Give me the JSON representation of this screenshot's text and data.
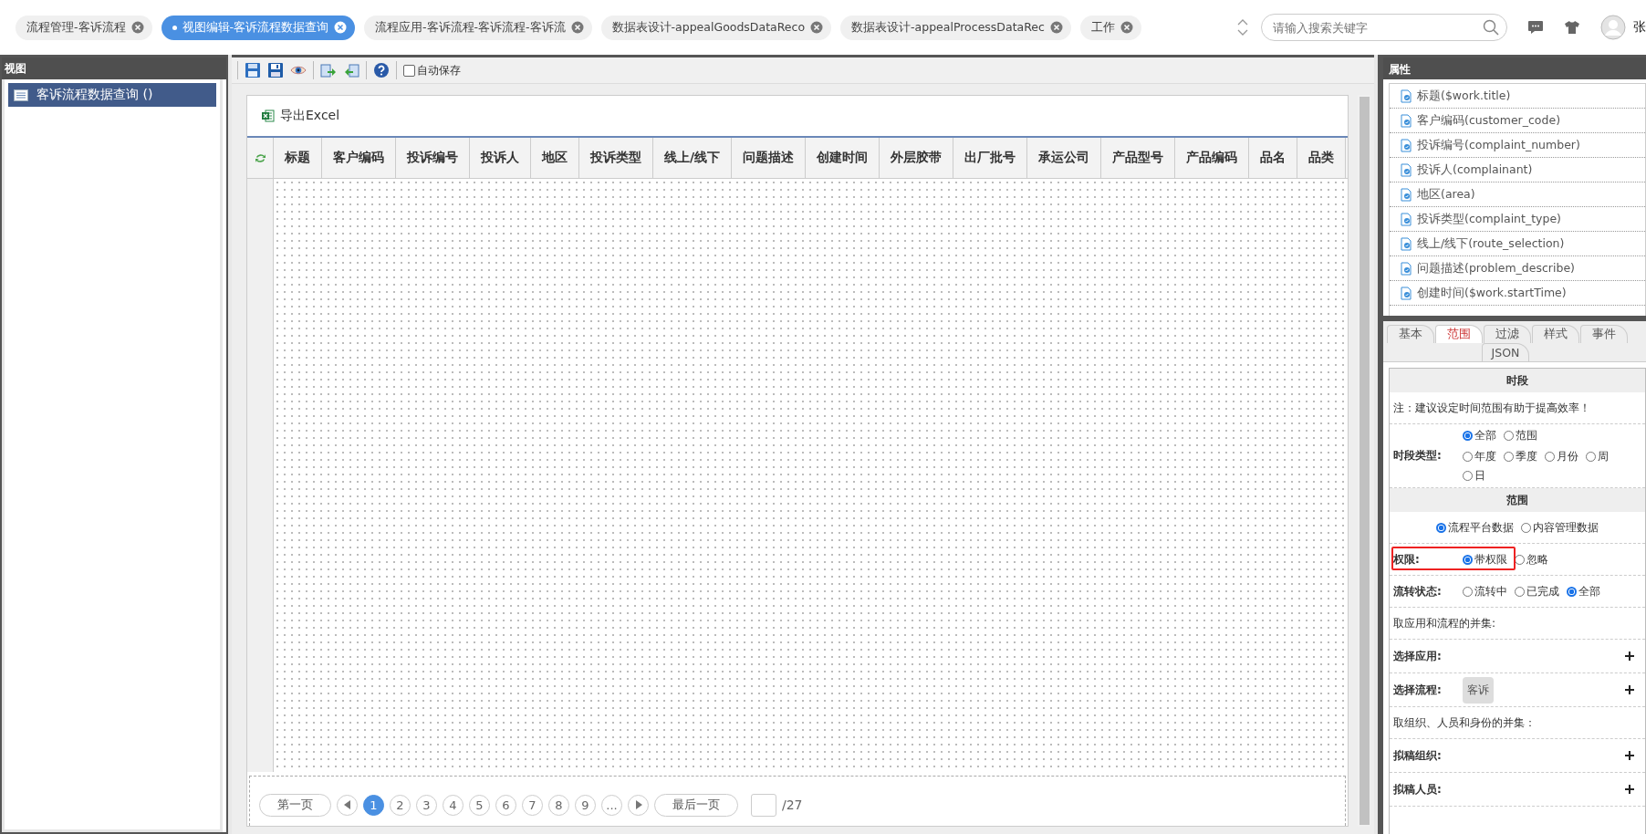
{
  "top_tabs": [
    {
      "label": "流程管理-客诉流程",
      "selected": false
    },
    {
      "label": "视图编辑-客诉流程数据查询",
      "selected": true
    },
    {
      "label": "流程应用-客诉流程-客诉流程-客诉流",
      "selected": false
    },
    {
      "label": "数据表设计-appealGoodsDataReco",
      "selected": false
    },
    {
      "label": "数据表设计-appealProcessDataRec",
      "selected": false
    },
    {
      "label": "工作",
      "selected": false
    }
  ],
  "search": {
    "placeholder": "请输入搜索关键字"
  },
  "user": {
    "name": "张"
  },
  "view_panel": {
    "title": "视图",
    "items": [
      {
        "label": "客诉流程数据查询 ()",
        "selected": true
      }
    ]
  },
  "toolbar": {
    "autosave": {
      "label": "自动保存",
      "checked": false
    }
  },
  "export_button": "导出Excel",
  "table": {
    "columns": [
      "标题",
      "客户编码",
      "投诉编号",
      "投诉人",
      "地区",
      "投诉类型",
      "线上/线下",
      "问题描述",
      "创建时间",
      "外层胶带",
      "出厂批号",
      "承运公司",
      "产品型号",
      "产品编码",
      "品名",
      "品类"
    ]
  },
  "pagination": {
    "first": "第一页",
    "pages": [
      {
        "label": "1",
        "selected": true
      },
      {
        "label": "2",
        "selected": false
      },
      {
        "label": "3",
        "selected": false
      },
      {
        "label": "4",
        "selected": false
      },
      {
        "label": "5",
        "selected": false
      },
      {
        "label": "6",
        "selected": false
      },
      {
        "label": "7",
        "selected": false
      },
      {
        "label": "8",
        "selected": false
      },
      {
        "label": "9",
        "selected": false
      }
    ],
    "ellipsis": "...",
    "last": "最后一页",
    "total": "/27"
  },
  "properties": {
    "title": "属性",
    "fields": [
      "标题($work.title)",
      "客户编码(customer_code)",
      "投诉编号(complaint_number)",
      "投诉人(complainant)",
      "地区(area)",
      "投诉类型(complaint_type)",
      "线上/线下(route_selection)",
      "问题描述(problem_describe)",
      "创建时间($work.startTime)"
    ]
  },
  "prop_tabs": [
    {
      "label": "基本",
      "selected": false
    },
    {
      "label": "范围",
      "selected": true
    },
    {
      "label": "过滤",
      "selected": false
    },
    {
      "label": "样式",
      "selected": false
    },
    {
      "label": "事件",
      "selected": false
    },
    {
      "label": "JSON",
      "selected": false
    }
  ],
  "scope_form": {
    "rows": [
      {
        "kind": "heading",
        "text": "时段"
      },
      {
        "kind": "note",
        "text": "注：建议设定时间范围有助于提高效率！"
      },
      {
        "kind": "radios",
        "label": "时段类型:",
        "option_lines": [
          [
            {
              "label": "全部",
              "selected": true
            },
            {
              "label": "范围",
              "selected": false
            }
          ],
          [
            {
              "label": "年度",
              "selected": false
            },
            {
              "label": "季度",
              "selected": false
            },
            {
              "label": "月份",
              "selected": false
            },
            {
              "label": "周",
              "selected": false
            },
            {
              "label": "日",
              "selected": false
            }
          ]
        ]
      },
      {
        "kind": "heading",
        "text": "范围"
      },
      {
        "kind": "radios",
        "option_lines": [
          [
            {
              "label": "流程平台数据",
              "selected": true
            },
            {
              "label": "内容管理数据",
              "selected": false
            }
          ]
        ]
      },
      {
        "kind": "radios",
        "label": "权限:",
        "highlighted": true,
        "option_lines": [
          [
            {
              "label": "带权限",
              "selected": true
            },
            {
              "label": "忽略",
              "selected": false
            }
          ]
        ]
      },
      {
        "kind": "radios",
        "label": "流转状态:",
        "option_lines": [
          [
            {
              "label": "流转中",
              "selected": false
            },
            {
              "label": "已完成",
              "selected": false
            },
            {
              "label": "全部",
              "selected": true
            }
          ]
        ]
      },
      {
        "kind": "note",
        "text": "取应用和流程的并集:"
      },
      {
        "kind": "picker",
        "label": "选择应用:",
        "chips": []
      },
      {
        "kind": "picker",
        "label": "选择流程:",
        "chips": [
          "客诉"
        ]
      },
      {
        "kind": "note",
        "text": "取组织、人员和身份的并集："
      },
      {
        "kind": "picker",
        "label": "拟稿组织:",
        "chips": []
      },
      {
        "kind": "picker",
        "label": "拟稿人员:",
        "chips": []
      }
    ]
  }
}
